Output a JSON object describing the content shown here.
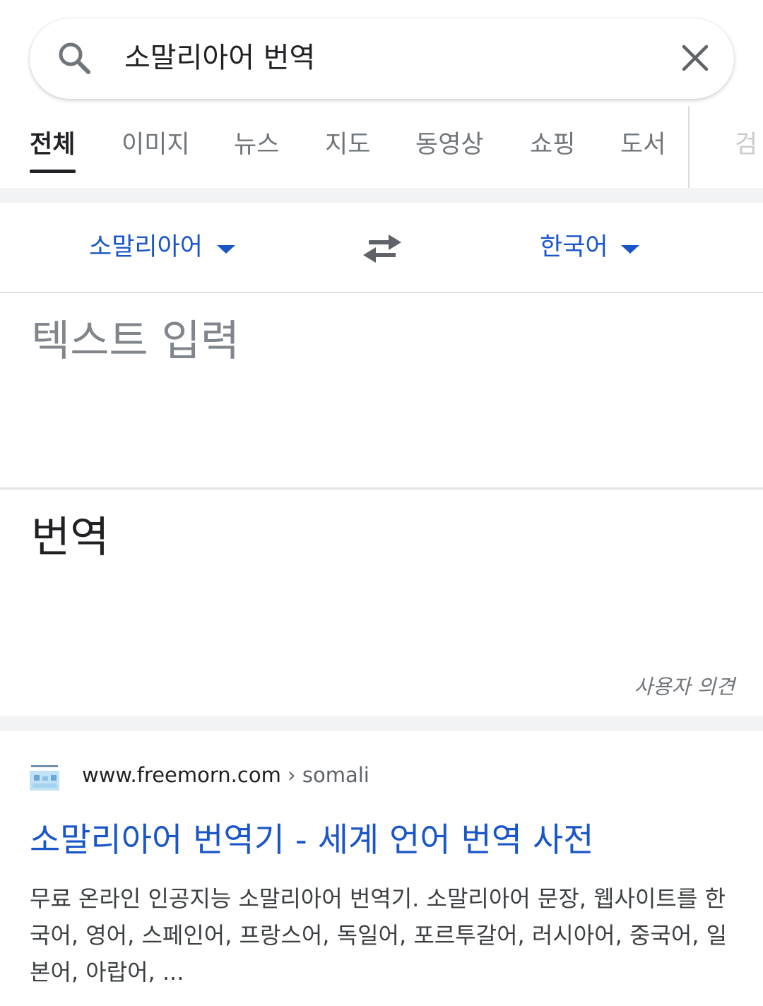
{
  "search": {
    "query": "소말리아어 번역"
  },
  "tabs": [
    {
      "label": "전체",
      "active": true
    },
    {
      "label": "이미지"
    },
    {
      "label": "뉴스"
    },
    {
      "label": "지도"
    },
    {
      "label": "동영상"
    },
    {
      "label": "쇼핑"
    },
    {
      "label": "도서"
    },
    {
      "label": "검"
    }
  ],
  "translator": {
    "source_lang": "소말리아어",
    "target_lang": "한국어",
    "input_placeholder": "텍스트 입력",
    "output_label": "번역",
    "feedback": "사용자 의견"
  },
  "result": {
    "favicon_text": "freemorn 소말리",
    "url_domain": "www.freemorn.com",
    "url_path": " › somali",
    "title": "소말리아어 번역기 - 세계 언어 번역 사전",
    "snippet": "무료 온라인 인공지능 소말리아어 번역기. 소말리아어 문장, 웹사이트를 한국어, 영어, 스페인어, 프랑스어, 독일어, 포르투갈어, 러시아어, 중국어, 일본어, 아랍어, ..."
  },
  "colors": {
    "link_blue": "#1a56c9",
    "text_dark": "#202124",
    "text_gray": "#70757a",
    "band_gray": "#f1f3f4"
  }
}
